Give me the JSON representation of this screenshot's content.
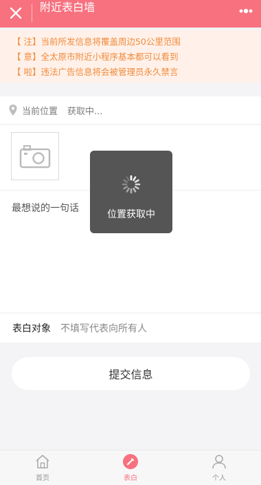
{
  "topbar": {
    "title": "附近表白墙",
    "close_icon": "close-icon",
    "more_icon": "more-icon"
  },
  "notice": {
    "lines": [
      "【 注】当前所发信息将覆盖周边50公里范围",
      "【 意】全太原市附近小程序基本都可以看到",
      "【 啦】违法广告信息将会被管理员永久禁言"
    ],
    "color": "#f08b3d"
  },
  "location": {
    "label": "当前位置",
    "value": "获取中..."
  },
  "card": {
    "wish_label": "最想说的一句话"
  },
  "target": {
    "label": "表白对象",
    "placeholder": "不填写代表向所有人"
  },
  "submit": {
    "label": "提交信息"
  },
  "tabs": [
    {
      "label": "首页",
      "icon": "home-icon",
      "active": false
    },
    {
      "label": "表白",
      "icon": "confess-icon",
      "active": true
    },
    {
      "label": "个人",
      "icon": "person-icon",
      "active": false
    }
  ],
  "toast": {
    "message": "位置获取中"
  },
  "colors": {
    "brand": "#f7717f",
    "notice_bg": "#fff1e9",
    "page_bg": "#f4f3f5"
  }
}
